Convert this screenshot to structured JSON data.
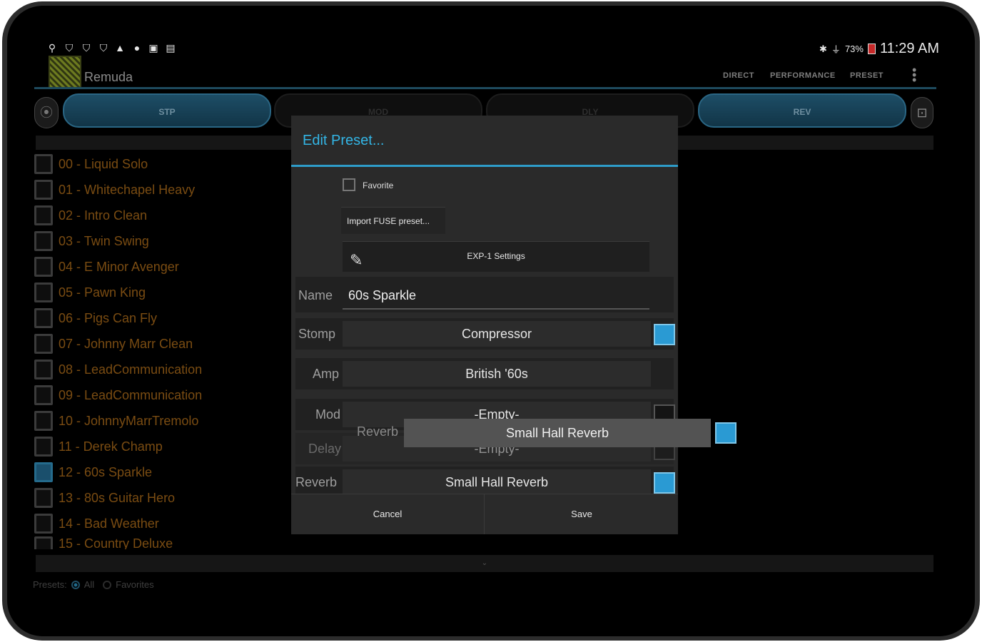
{
  "status_bar": {
    "left_icons": [
      "usb-icon",
      "shield-icon",
      "shield-icon",
      "shield-icon",
      "warning-icon",
      "location-icon",
      "camera-icon",
      "photo-icon"
    ],
    "battery": "73%",
    "time": "11:29 AM"
  },
  "app_bar": {
    "title": "Remuda",
    "menu": [
      "DIRECT",
      "PERFORMANCE",
      "PRESET"
    ]
  },
  "effects": {
    "stp": "STP",
    "mod": "MOD",
    "dly": "DLY",
    "rev": "REV"
  },
  "presets": [
    "00 - Liquid Solo",
    "01 - Whitechapel Heavy",
    "02 - Intro Clean",
    "03 - Twin Swing",
    "04 - E Minor Avenger",
    "05 - Pawn King",
    "06 - Pigs Can Fly",
    "07 - Johnny Marr Clean",
    "08 - LeadCommunication",
    "09 - LeadCommunication",
    "10 - JohnnyMarrTremolo",
    "11 - Derek Champ",
    "12 - 60s Sparkle",
    "13 - 80s Guitar Hero",
    "14 - Bad Weather",
    "15 - Country Deluxe"
  ],
  "selected_preset_index": 12,
  "filter": {
    "label": "Presets:",
    "all": "All",
    "favorites": "Favorites"
  },
  "dialog": {
    "title": "Edit Preset...",
    "favorite_label": "Favorite",
    "import_button": "Import FUSE preset...",
    "exp_button": "EXP-1 Settings",
    "name_label": "Name",
    "name_value": "60s Sparkle",
    "rows": {
      "stomp": {
        "label": "Stomp",
        "value": "Compressor"
      },
      "amp": {
        "label": "Amp",
        "value": "British '60s"
      },
      "mod": {
        "label": "Mod",
        "value": "-Empty-"
      },
      "delay": {
        "label": "Delay",
        "value": "-Empty-"
      },
      "reverb": {
        "label": "Reverb",
        "value": "Small Hall Reverb"
      }
    },
    "drag_overlay": {
      "label": "Reverb",
      "value": "Small Hall Reverb"
    },
    "cancel": "Cancel",
    "save": "Save"
  }
}
